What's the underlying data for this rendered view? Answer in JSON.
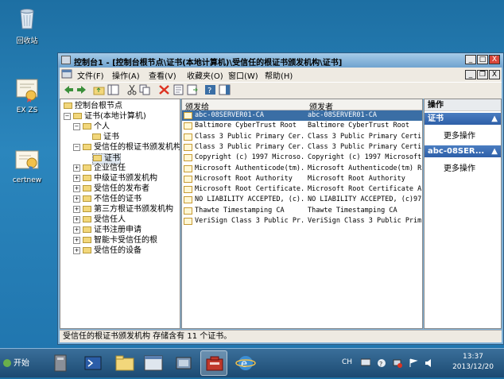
{
  "desktop": {
    "icons": [
      {
        "label": "回收站"
      },
      {
        "label": "EX ZS"
      },
      {
        "label": "certnew"
      }
    ]
  },
  "window": {
    "title": "控制台1 - [控制台根节点\\证书(本地计算机)\\受信任的根证书颁发机构\\证书]",
    "controls": {
      "minimize": "_",
      "maximize": "□",
      "close": "X"
    },
    "inner_controls": {
      "minimize": "_",
      "restore": "❐",
      "close": "X"
    }
  },
  "menubar": {
    "items": [
      "文件(F)",
      "操作(A)",
      "查看(V)",
      "收藏夹(O)",
      "窗口(W)",
      "帮助(H)"
    ]
  },
  "tree": {
    "nodes": [
      {
        "label": "控制台根节点",
        "level": 0
      },
      {
        "label": "证书(本地计算机)",
        "level": 1
      },
      {
        "label": "个人",
        "level": 2
      },
      {
        "label": "证书",
        "level": 3
      },
      {
        "label": "受信任的根证书颁发机构",
        "level": 2
      },
      {
        "label": "证书",
        "level": 3
      },
      {
        "label": "企业信任",
        "level": 2
      },
      {
        "label": "中级证书颁发机构",
        "level": 2
      },
      {
        "label": "受信任的发布者",
        "level": 2
      },
      {
        "label": "不信任的证书",
        "level": 2
      },
      {
        "label": "第三方根证书颁发机构",
        "level": 2
      },
      {
        "label": "受信任人",
        "level": 2
      },
      {
        "label": "证书注册申请",
        "level": 2
      },
      {
        "label": "智能卡受信任的根",
        "level": 2
      },
      {
        "label": "受信任的设备",
        "level": 2
      }
    ]
  },
  "list": {
    "headers": {
      "issued_to": "颁发给",
      "issued_by": "颁发者"
    },
    "rows": [
      {
        "issued_to": "abc-08SERVER01-CA",
        "issued_by": "abc-08SERVER01-CA"
      },
      {
        "issued_to": "Baltimore CyberTrust Root",
        "issued_by": "Baltimore CyberTrust Root"
      },
      {
        "issued_to": "Class 3 Public Primary Cer...",
        "issued_by": "Class 3 Public Primary Certi..."
      },
      {
        "issued_to": "Class 3 Public Primary Cer...",
        "issued_by": "Class 3 Public Primary Certi..."
      },
      {
        "issued_to": "Copyright (c) 1997 Microso...",
        "issued_by": "Copyright (c) 1997 Microsoft..."
      },
      {
        "issued_to": "Microsoft Authenticode(tm)...",
        "issued_by": "Microsoft Authenticode(tm) R..."
      },
      {
        "issued_to": "Microsoft Root Authority",
        "issued_by": "Microsoft Root Authority"
      },
      {
        "issued_to": "Microsoft Root Certificate...",
        "issued_by": "Microsoft Root Certificate A..."
      },
      {
        "issued_to": "NO LIABILITY ACCEPTED, (c)...",
        "issued_by": "NO LIABILITY ACCEPTED, (c)97..."
      },
      {
        "issued_to": "Thawte Timestamping CA",
        "issued_by": "Thawte Timestamping CA"
      },
      {
        "issued_to": "VeriSign Class 3 Public Pr...",
        "issued_by": "VeriSign Class 3 Public Prim..."
      }
    ]
  },
  "actions": {
    "title": "操作",
    "sections": [
      {
        "header": "证书",
        "item": "更多操作"
      },
      {
        "header": "abc-08SER...",
        "item": "更多操作"
      }
    ]
  },
  "status": {
    "text": "受信任的根证书颁发机构 存储含有 11 个证书。"
  },
  "taskbar": {
    "start_label": "开始",
    "lang": "CH",
    "time": "13:37",
    "date": "2013/12/20"
  },
  "colors": {
    "selection": "#3a6ea5",
    "action_header": "#2e5fa8",
    "desktop": "#1f74ad"
  }
}
